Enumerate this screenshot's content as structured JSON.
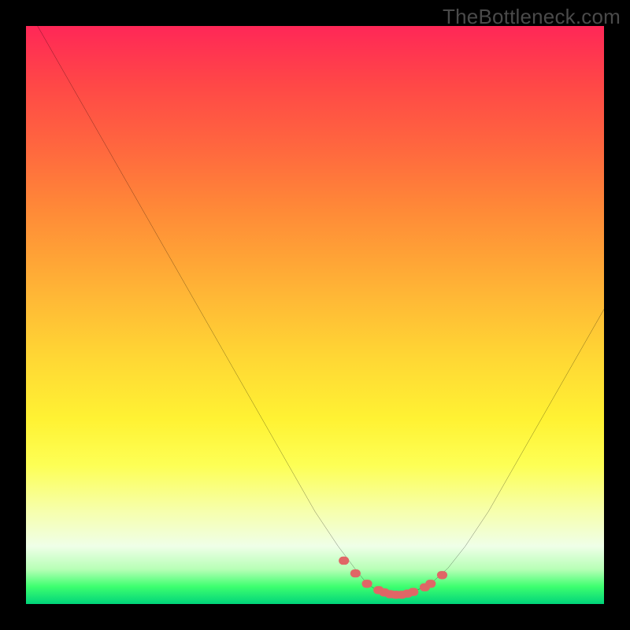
{
  "watermark": "TheBottleneck.com",
  "accent_curve_color": "#000000",
  "dot_color": "#e06666",
  "chart_data": {
    "type": "line",
    "title": "",
    "xlabel": "",
    "ylabel": "",
    "xlim": [
      0,
      100
    ],
    "ylim": [
      0,
      100
    ],
    "background_gradient": "bottleneck-heat",
    "series": [
      {
        "name": "bottleneck-curve",
        "x": [
          2,
          6,
          10,
          14,
          18,
          22,
          26,
          30,
          34,
          38,
          42,
          46,
          50,
          54,
          57,
          59,
          61,
          63,
          65,
          67,
          70,
          73,
          76,
          80,
          84,
          88,
          92,
          96,
          100
        ],
        "y": [
          100,
          93,
          86,
          79,
          72,
          65,
          58,
          51,
          44,
          37,
          30,
          23,
          16,
          10,
          6,
          3.5,
          2.2,
          1.6,
          1.6,
          2.1,
          3.5,
          6.2,
          10,
          16,
          23,
          30,
          37,
          44,
          51
        ]
      }
    ],
    "markers": {
      "name": "highlight-dots",
      "x": [
        55,
        57,
        59,
        61,
        62,
        63,
        64,
        65,
        66,
        67,
        69,
        70,
        72
      ],
      "y": [
        7.5,
        5.3,
        3.5,
        2.4,
        2.0,
        1.7,
        1.6,
        1.6,
        1.8,
        2.1,
        2.9,
        3.5,
        5.0
      ]
    }
  }
}
